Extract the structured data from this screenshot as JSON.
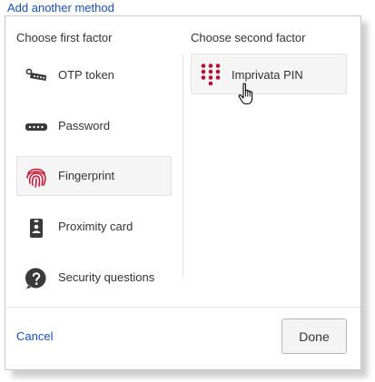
{
  "header": {
    "add_method_link": "Add another method"
  },
  "dialog": {
    "first_factor_title": "Choose first factor",
    "second_factor_title": "Choose second factor",
    "first_factors": [
      {
        "label": "OTP token",
        "icon": "otp-token-icon"
      },
      {
        "label": "Password",
        "icon": "password-icon"
      },
      {
        "label": "Fingerprint",
        "icon": "fingerprint-icon",
        "selected": true
      },
      {
        "label": "Proximity card",
        "icon": "proximity-card-icon"
      },
      {
        "label": "Security questions",
        "icon": "security-questions-icon"
      }
    ],
    "second_factors": [
      {
        "label": "Imprivata PIN",
        "icon": "pin-keypad-icon",
        "hovered": true
      }
    ],
    "cancel_label": "Cancel",
    "done_label": "Done"
  },
  "colors": {
    "link": "#1a4fb7",
    "fingerprint": "#c8102e",
    "pin": "#b5123a",
    "icon_dark": "#3a3a3a"
  }
}
